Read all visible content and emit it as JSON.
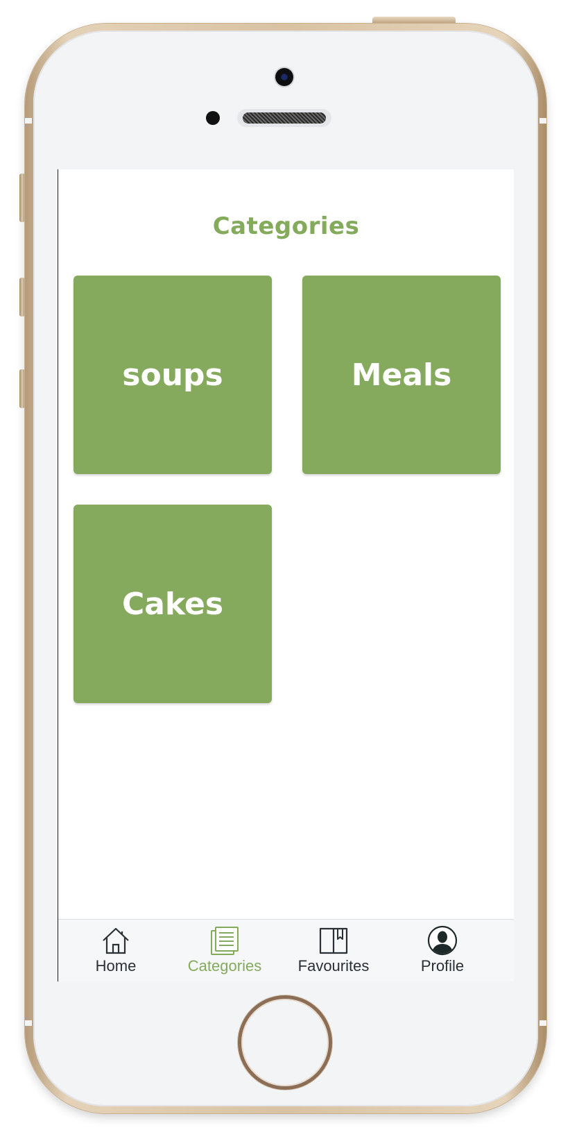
{
  "header": {
    "title": "Categories"
  },
  "categories": [
    {
      "label": "soups"
    },
    {
      "label": "Meals"
    },
    {
      "label": "Cakes"
    }
  ],
  "tabbar": {
    "active": "categories",
    "items": [
      {
        "key": "home",
        "label": "Home",
        "icon": "home-icon"
      },
      {
        "key": "categories",
        "label": "Categories",
        "icon": "categories-list-icon"
      },
      {
        "key": "favourites",
        "label": "Favourites",
        "icon": "bookmark-book-icon"
      },
      {
        "key": "profile",
        "label": "Profile",
        "icon": "profile-avatar-icon"
      }
    ]
  },
  "colors": {
    "accent": "#84aa5c",
    "tile": "#85aa5d",
    "tab_inactive": "#2a2f36",
    "tabbar_bg": "#f6f7f8"
  }
}
